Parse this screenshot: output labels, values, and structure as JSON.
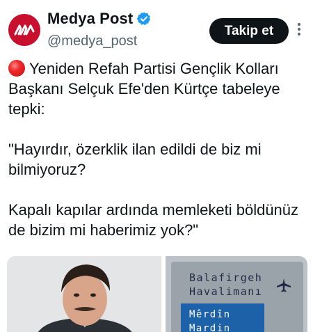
{
  "account": {
    "display_name": "Medya Post",
    "handle": "@medya_post",
    "verified": true,
    "brand_color": "#c8102e",
    "avatar_icon": "medya-post-logo"
  },
  "follow_button": {
    "label": "Takip et"
  },
  "more_menu": {
    "icon": "more-vertical-icon"
  },
  "tweet": {
    "paragraphs": [
      "Yeniden Refah Partisi Gençlik Kolları Başkanı Selçuk Efe'den Kürtçe tabeleye tepki:",
      "\"Hayırdır, özerklik ilan edildi de biz mi bilmiyoruz?",
      "Kapalı kapılar ardında memleketi böldünüz de bizim mi haberimiz yok?\""
    ],
    "lead_icon": "red-circle-emoji"
  },
  "media": {
    "images": [
      {
        "label": "photo-of-man"
      },
      {
        "label": "airport-sign-photo",
        "sign_text": [
          "Balafirgeh",
          "Havalimanı",
          "Mêrdîn",
          "Mardin"
        ]
      }
    ]
  }
}
